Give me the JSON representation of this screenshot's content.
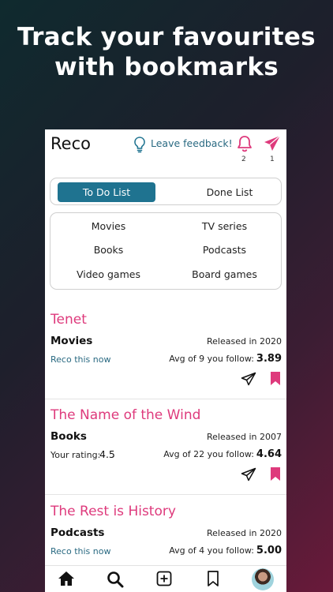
{
  "promo": {
    "line1": "Track your favourites",
    "line2": "with bookmarks"
  },
  "app": {
    "name": "Reco",
    "feedback_label": "Leave feedback!",
    "notifications_count": "2",
    "sent_count": "1",
    "accent_color": "#de3a7c",
    "primary_color": "#1f7390"
  },
  "tabs": {
    "active": "To Do List",
    "inactive": "Done List"
  },
  "categories": [
    "Movies",
    "TV series",
    "Books",
    "Podcasts",
    "Video games",
    "Board games"
  ],
  "items": [
    {
      "title": "Tenet",
      "type": "Movies",
      "released": "Released in 2020",
      "left_text": "Reco this now",
      "avg_label": "Avg of 9 you follow:",
      "avg_value": "3.89"
    },
    {
      "title": "The Name of the Wind",
      "type": "Books",
      "released": "Released in 2007",
      "rating_label": "Your rating:",
      "rating_value": "4.5",
      "avg_label": "Avg of 22 you follow:",
      "avg_value": "4.64"
    },
    {
      "title": "The Rest is History",
      "type": "Podcasts",
      "released": "Released in 2020",
      "left_text": "Reco this now",
      "avg_label": "Avg of 4 you follow:",
      "avg_value": "5.00"
    }
  ],
  "bottom_nav": [
    "home-icon",
    "search-icon",
    "add-icon",
    "bookmarks-icon",
    "profile-avatar"
  ]
}
